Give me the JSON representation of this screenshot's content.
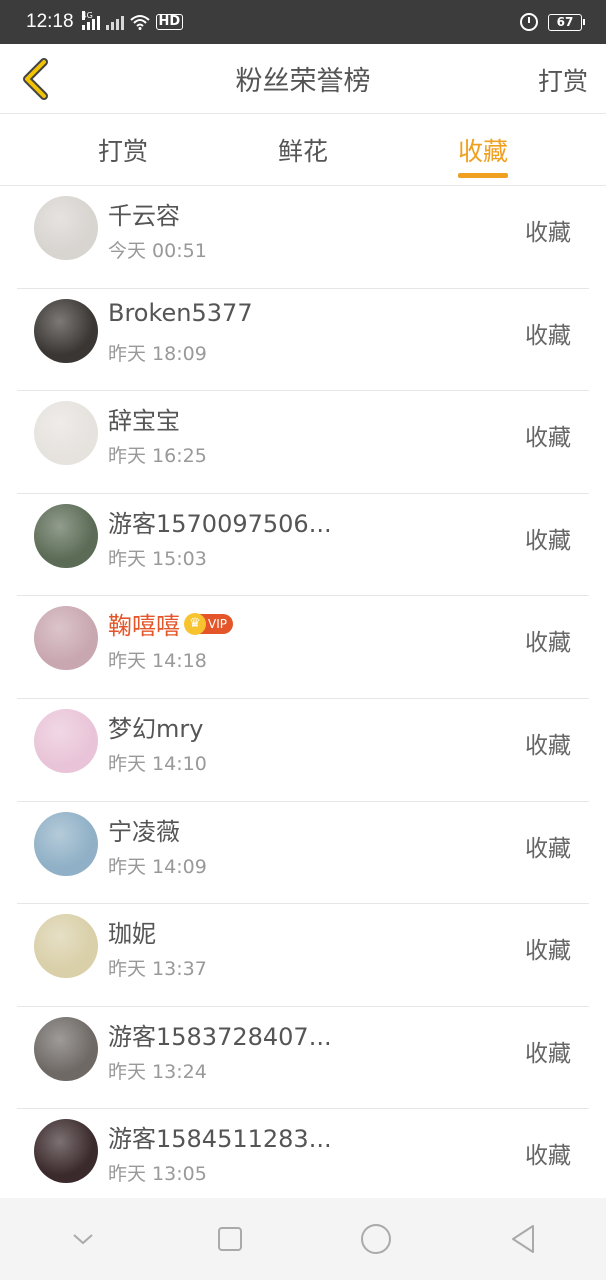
{
  "status_bar": {
    "time": "12:18",
    "network": "4G",
    "hd": "HD",
    "battery": "67"
  },
  "header": {
    "title": "粉丝荣誉榜",
    "action": "打赏"
  },
  "tabs": [
    {
      "label": "打赏",
      "active": false
    },
    {
      "label": "鲜花",
      "active": false
    },
    {
      "label": "收藏",
      "active": true
    }
  ],
  "vip_label": "VIP",
  "rows": [
    {
      "name": "千云容",
      "time": "今天 00:51",
      "action": "收藏",
      "avatar_color": "#d8d4d0"
    },
    {
      "name": "Broken5377",
      "time": "昨天 18:09",
      "action": "收藏",
      "avatar_color": "#3a3633"
    },
    {
      "name": "辞宝宝",
      "time": "昨天 16:25",
      "action": "收藏",
      "avatar_color": "#e6e2de"
    },
    {
      "name": "游客1570097506...",
      "time": "昨天 15:03",
      "action": "收藏",
      "avatar_color": "#5b6b55"
    },
    {
      "name": "鞠嘻嘻",
      "time": "昨天 14:18",
      "action": "收藏",
      "avatar_color": "#c9a7b0",
      "vip": true
    },
    {
      "name": "梦幻mry",
      "time": "昨天 14:10",
      "action": "收藏",
      "avatar_color": "#e9c4d8"
    },
    {
      "name": "宁凌薇",
      "time": "昨天 14:09",
      "action": "收藏",
      "avatar_color": "#8fb0c6"
    },
    {
      "name": "珈妮",
      "time": "昨天 13:37",
      "action": "收藏",
      "avatar_color": "#d9cfa8"
    },
    {
      "name": "游客1583728407...",
      "time": "昨天 13:24",
      "action": "收藏",
      "avatar_color": "#6e6965"
    },
    {
      "name": "游客1584511283...",
      "time": "昨天 13:05",
      "action": "收藏",
      "avatar_color": "#3b2a2c"
    }
  ],
  "colors": {
    "accent": "#f0a020",
    "vip_name": "#e4562a",
    "status_bar": "#3c3c3c"
  }
}
